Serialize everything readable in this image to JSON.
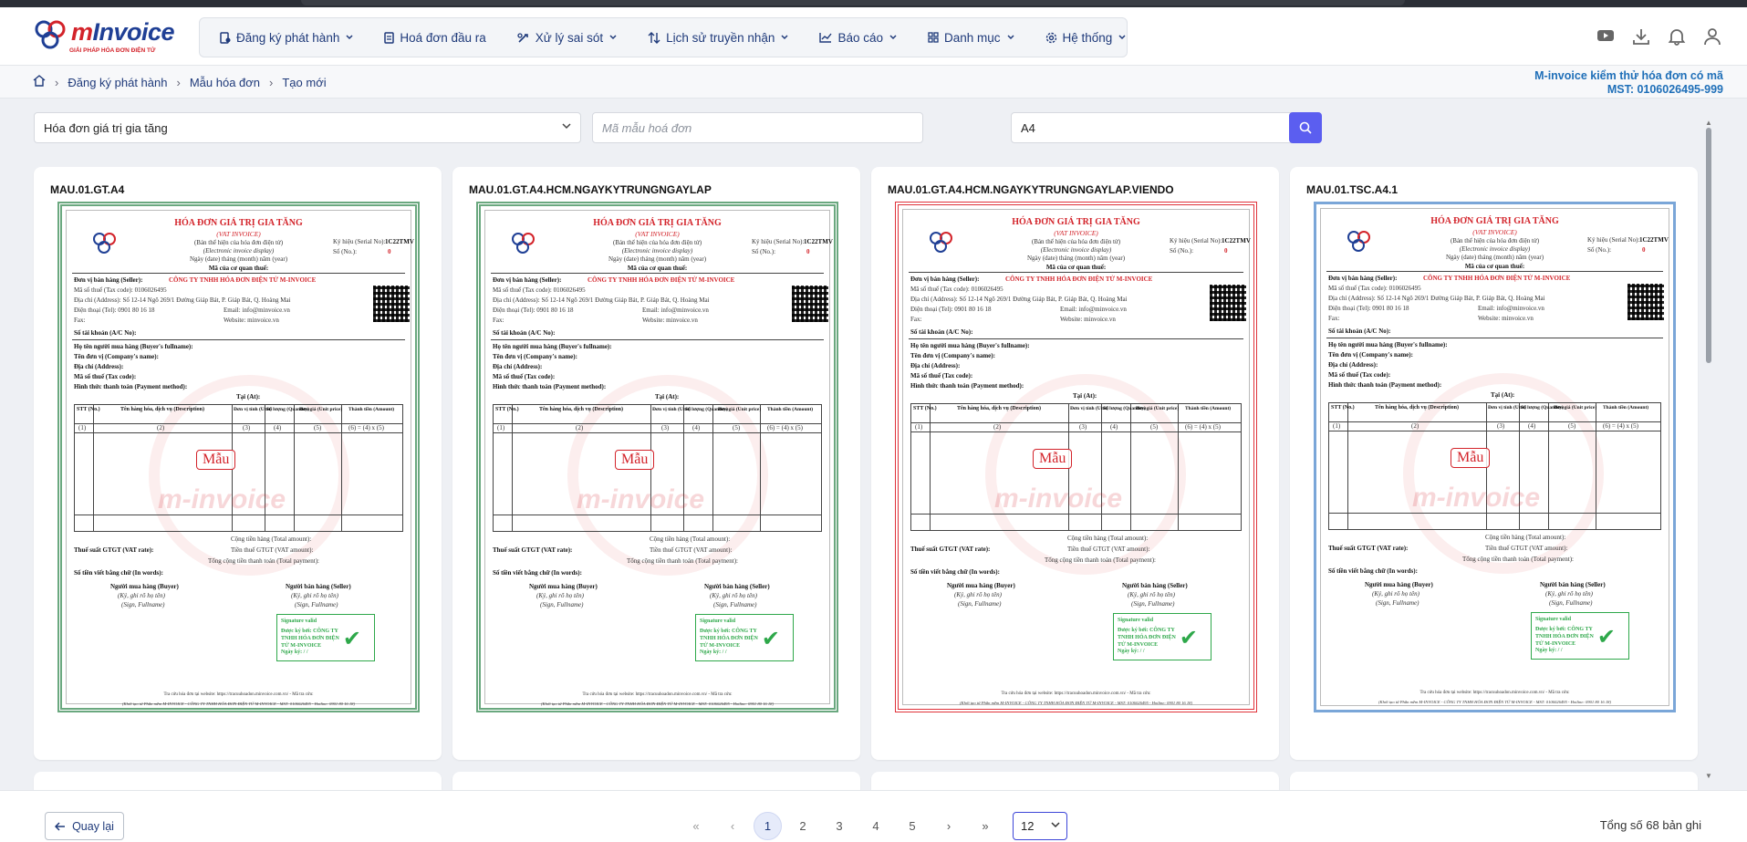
{
  "app": {
    "logo_text_main": "Invoice",
    "logo_text_m": "m",
    "logo_tagline": "GIẢI PHÁP HÓA ĐƠN ĐIỆN TỬ"
  },
  "nav": [
    {
      "label": "Đăng ký phát hành",
      "icon": "document-register-icon",
      "dropdown": true
    },
    {
      "label": "Hoá đơn đầu ra",
      "icon": "invoice-out-icon",
      "dropdown": false
    },
    {
      "label": "Xử lý sai sót",
      "icon": "error-handling-icon",
      "dropdown": true
    },
    {
      "label": "Lịch sử truyền nhận",
      "icon": "transfer-history-icon",
      "dropdown": true
    },
    {
      "label": "Báo cáo",
      "icon": "chart-icon",
      "dropdown": true
    },
    {
      "label": "Danh mục",
      "icon": "grid-icon",
      "dropdown": true
    },
    {
      "label": "Hệ thống",
      "icon": "gear-icon",
      "dropdown": true
    }
  ],
  "header_icons": [
    "youtube-icon",
    "download-icon",
    "bell-icon",
    "user-icon"
  ],
  "breadcrumb": [
    "Đăng ký phát hành",
    "Mẫu hóa đơn",
    "Tạo mới"
  ],
  "company": {
    "name": "M-invoice kiểm thử hóa đơn có mã",
    "tax_code": "MST: 0106026495-999"
  },
  "filters": {
    "invoice_type": "Hóa đơn giá trị gia tăng",
    "template_code_placeholder": "Mã mẫu hoá đơn",
    "paper_size": "A4"
  },
  "templates": [
    {
      "code": "MAU.01.GT.A4",
      "border": "green"
    },
    {
      "code": "MAU.01.GT.A4.HCM.NGAYKYTRUNGNGAYLAP",
      "border": "green"
    },
    {
      "code": "MAU.01.GT.A4.HCM.NGAYKYTRUNGNGAYLAP.VIENDO",
      "border": "red"
    },
    {
      "code": "MAU.01.TSC.A4.1",
      "border": "blue"
    }
  ],
  "doc": {
    "title": "HÓA ĐƠN GIÁ TRỊ GIA TĂNG",
    "subtitle": "(VAT INVOICE)",
    "display_note": "(Bản thể hiện của hóa đơn điện tử)",
    "display_note_en": "(Electronic invoice display)",
    "date_line": "Ngày (date)   tháng (month)   năm (year)",
    "authority_code": "Mã của cơ quan thuế:",
    "serial_label": "Ký hiệu (Serial No):",
    "serial_value": "1C22TMV",
    "number_label": "Số (No.):",
    "number_value": "0",
    "seller_label": "Đơn vị bán hàng (Seller):",
    "seller_name": "CÔNG TY TNHH HÓA ĐƠN ĐIỆN TỬ M-INVOICE",
    "tax_code_line": "Mã số thuế (Tax code): 0106026495",
    "address_line": "Địa chỉ (Address): Số 12-14 Ngõ 269/1 Đường Giáp Bát, P. Giáp Bát, Q. Hoàng Mai",
    "phone_line": "Điện thoại (Tel): 0901 80 16 18",
    "email_line": "Email: info@minvoice.vn",
    "fax_line": "Fax:",
    "website_line": "Website: minvoice.vn",
    "account_line": "Số tài khoản (A/C No):",
    "buyer_line": "Họ tên người mua hàng (Buyer's fullname):",
    "company_line": "Tên đơn vị (Company's name):",
    "buyer_address_line": "Địa chỉ (Address):",
    "buyer_tax_line": "Mã số thuế (Tax code):",
    "payment_line": "Hình thức thanh toán (Payment method):",
    "at_line": "Tại (At):",
    "table_headers": [
      "STT (No.)",
      "Tên hàng hóa, dịch vụ (Description)",
      "Đơn vị tính (Unit)",
      "Số lượng (Quantity)",
      "Đơn giá (Unit price)",
      "Thành tiền (Amount)"
    ],
    "table_index": [
      "(1)",
      "(2)",
      "(3)",
      "(4)",
      "(5)",
      "(6) = (4) x (5)"
    ],
    "sample_stamp": "Mẫu",
    "watermark": "m-invoice",
    "total_amount": "Cộng tiền hàng (Total amount):",
    "vat_rate": "Thuế suất GTGT (VAT rate):",
    "vat_amount": "Tiền thuế GTGT (VAT amount):",
    "total_payment": "Tổng cộng tiền thanh toán (Total payment):",
    "in_words": "Số tiền viết bằng chữ (In words):",
    "buyer_sign": "Người mua hàng (Buyer)",
    "seller_sign": "Người bán hàng (Seller)",
    "sign_note": "(Ký, ghi rõ họ tên)",
    "sign_note_en": "(Sign, Fullname)",
    "sig_valid": "Signature valid",
    "sig_by": "Được ký bởi: CÔNG TY TNHH HÓA ĐƠN ĐIỆN TỬ M-INVOICE",
    "sig_date": "Ngày ký: / /",
    "lookup_line": "Tra cứu hóa đơn tại website: https://tracuuhoadon.minvoice.com.vn/ - Mã tra cứu:",
    "footer_line": "(Khởi tạo từ Phần mềm M-INVOICE - CÔNG TY TNHH HÓA ĐƠN ĐIỆN TỬ M-INVOICE - MST: 0106026495 - Hotline: 0901 80 16 18)"
  },
  "footer": {
    "back_label": "Quay lại",
    "pages": [
      "1",
      "2",
      "3",
      "4",
      "5"
    ],
    "current_page": "1",
    "page_size": "12",
    "total_text": "Tổng số 68 bản ghi"
  }
}
